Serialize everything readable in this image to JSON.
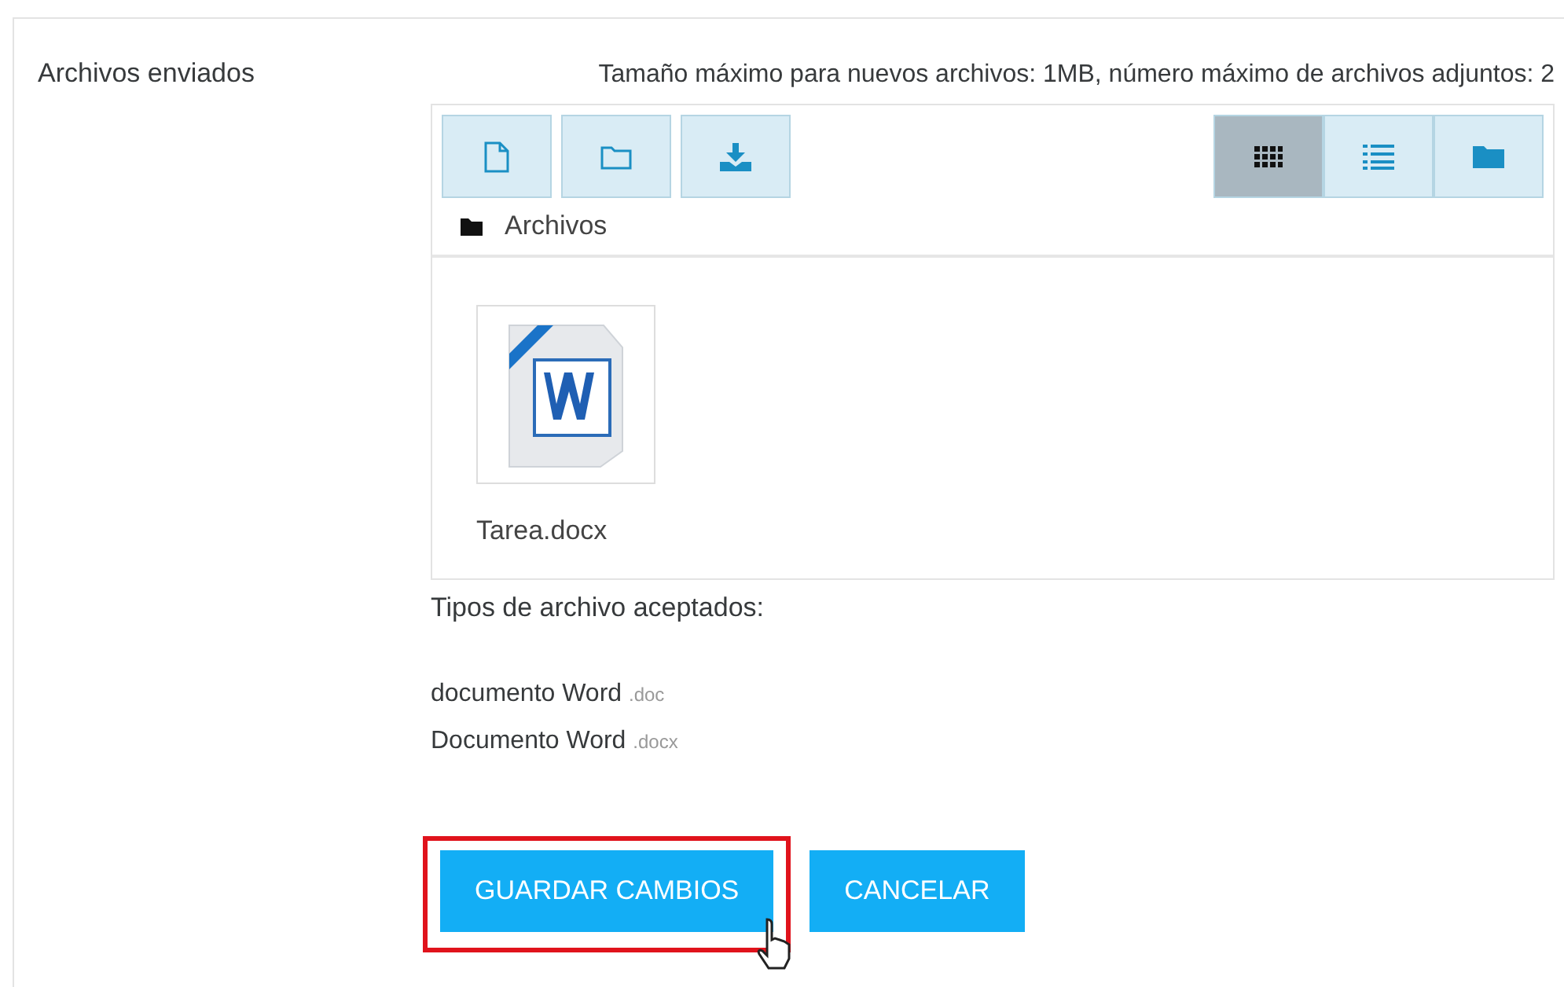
{
  "field_label": "Archivos enviados",
  "size_info": "Tamaño máximo para nuevos archivos: 1MB, número máximo de archivos adjuntos: 2",
  "actions": [
    {
      "kind": "file"
    },
    {
      "kind": "folder"
    },
    {
      "kind": "download"
    }
  ],
  "views": [
    {
      "kind": "grid",
      "selected": true
    },
    {
      "kind": "list",
      "selected": false
    },
    {
      "kind": "tree",
      "selected": false
    }
  ],
  "path": "Archivos",
  "files": [
    {
      "name": "Tarea.docx"
    }
  ],
  "accepted_title": "Tipos de archivo aceptados:",
  "file_types": [
    {
      "name": "documento Word",
      "ext": ".doc"
    },
    {
      "name": "Documento Word",
      "ext": ".docx"
    }
  ],
  "buttons": [
    {
      "label": "GUARDAR CAMBIOS"
    },
    {
      "label": "CANCELAR"
    }
  ],
  "save_button_frame": true
}
